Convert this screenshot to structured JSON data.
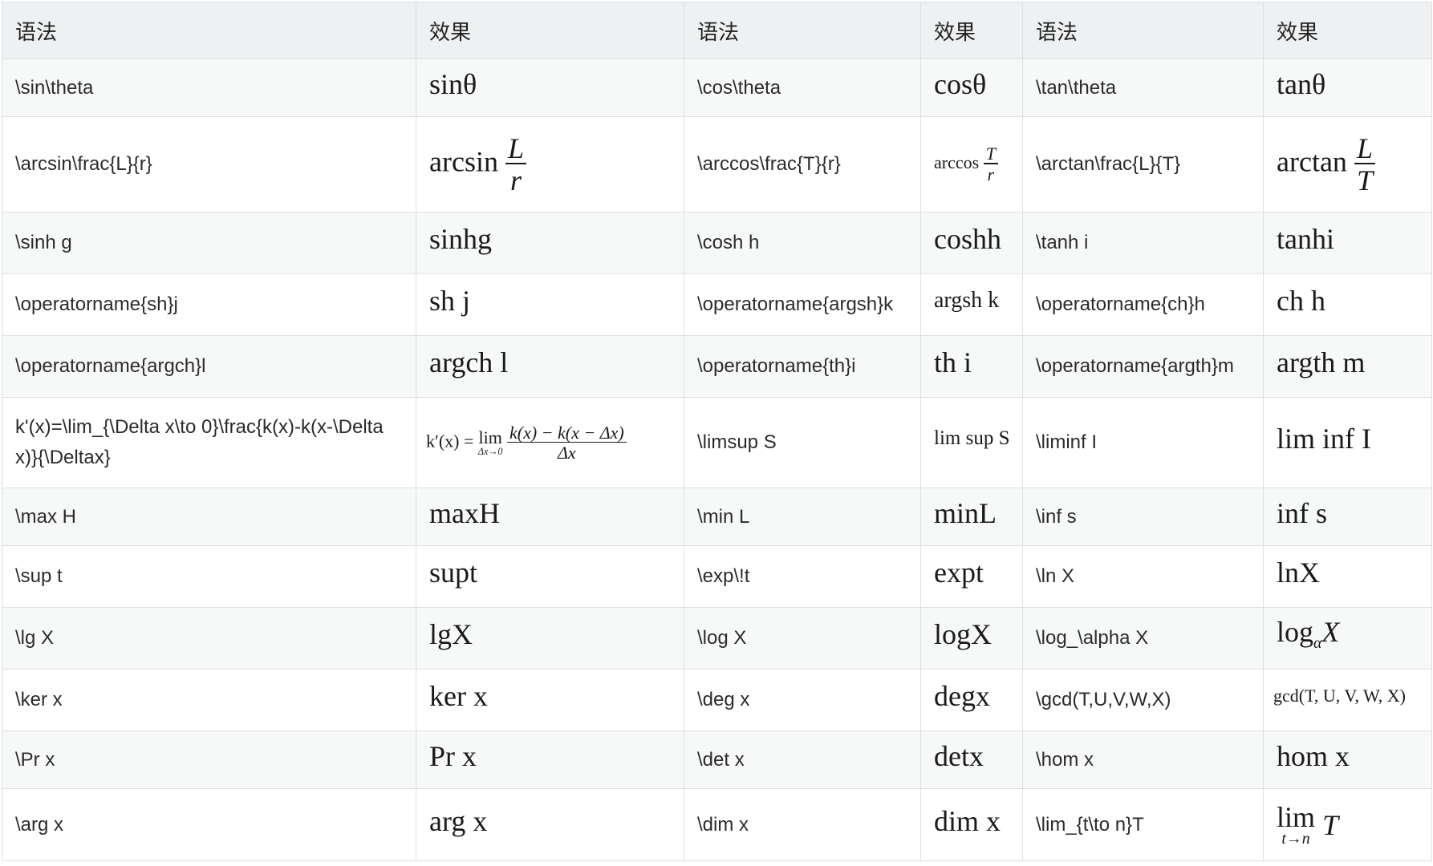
{
  "header": {
    "syntax_label": "语法",
    "effect_label": "效果"
  },
  "rows": [
    {
      "s1": "\\sin\\theta",
      "e1": "sinθ",
      "s2": "\\cos\\theta",
      "e2": "cosθ",
      "s3": "\\tan\\theta",
      "e3": "tanθ"
    },
    {
      "s1": "\\arcsin\\frac{L}{r}",
      "e1_op": "arcsin",
      "e1_num": "L",
      "e1_den": "r",
      "s2": "\\arccos\\frac{T}{r}",
      "e2_op": "arccos",
      "e2_num": "T",
      "e2_den": "r",
      "s3": "\\arctan\\frac{L}{T}",
      "e3_op": "arctan",
      "e3_num": "L",
      "e3_den": "T"
    },
    {
      "s1": "\\sinh g",
      "e1": "sinhg",
      "s2": "\\cosh h",
      "e2": "coshh",
      "s3": "\\tanh i",
      "e3": "tanhi"
    },
    {
      "s1": "\\operatorname{sh}j",
      "e1": "sh j",
      "s2": "\\operatorname{argsh}k",
      "e2": "argsh k",
      "s3": "\\operatorname{ch}h",
      "e3": "ch h"
    },
    {
      "s1": "\\operatorname{argch}l",
      "e1": "argch l",
      "s2": "\\operatorname{th}i",
      "e2": "th i",
      "s3": "\\operatorname{argth}m",
      "e3": "argth m"
    },
    {
      "s1": "k'(x)=\\lim_{\\Delta x\\to 0}\\frac{k(x)-k(x-\\Delta x)}{\\Deltax}",
      "e1_lhs": "k′(x) =",
      "e1_lim": "lim",
      "e1_sub": "Δx→0",
      "e1_num": "k(x) − k(x − Δx)",
      "e1_den": "Δx",
      "s2": "\\limsup S",
      "e2": "lim sup S",
      "s3": "\\liminf I",
      "e3": "lim inf I"
    },
    {
      "s1": "\\max H",
      "e1": "maxH",
      "s2": "\\min L",
      "e2": "minL",
      "s3": "\\inf s",
      "e3": "inf s"
    },
    {
      "s1": "\\sup t",
      "e1": "supt",
      "s2": "\\exp\\!t",
      "e2": "expt",
      "s3": "\\ln X",
      "e3": "lnX"
    },
    {
      "s1": "\\lg X",
      "e1": "lgX",
      "s2": "\\log X",
      "e2": "logX",
      "s3": "\\log_\\alpha X",
      "e3_op": "log",
      "e3_sub": "α",
      "e3_arg": "X"
    },
    {
      "s1": "\\ker x",
      "e1": "ker x",
      "s2": "\\deg x",
      "e2": "degx",
      "s3": "\\gcd(T,U,V,W,X)",
      "e3": "gcd(T, U, V, W, X)"
    },
    {
      "s1": "\\Pr x",
      "e1": "Pr x",
      "s2": "\\det x",
      "e2": "detx",
      "s3": "\\hom x",
      "e3": "hom x"
    },
    {
      "s1": "\\arg x",
      "e1": "arg x",
      "s2": "\\dim x",
      "e2": "dim x",
      "s3": "\\lim_{t\\to n}T",
      "e3_lim": "lim",
      "e3_sub": "t→n",
      "e3_arg": "T"
    }
  ]
}
